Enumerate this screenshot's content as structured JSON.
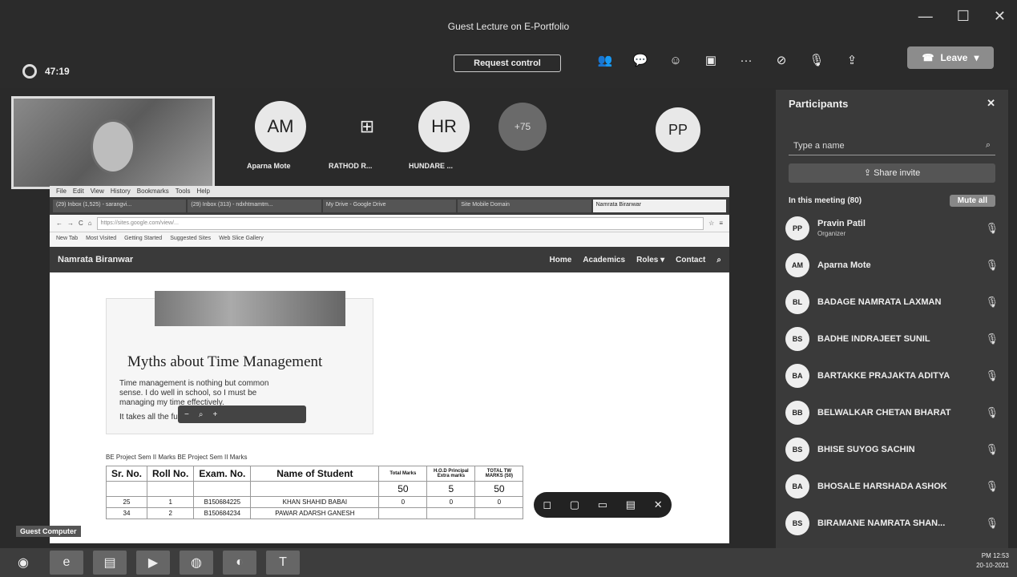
{
  "window": {
    "title": "Guest Lecture on E-Portfolio",
    "controls": [
      "—",
      "☐",
      "✕"
    ]
  },
  "meeting": {
    "timer": "47:19",
    "request_control": "Request control",
    "toolbar_icons": [
      "people-icon",
      "chat-icon",
      "reactions-icon",
      "view-icon",
      "more-icon",
      "camera-off-icon",
      "mic-off-icon",
      "share-icon"
    ],
    "leave_label": "Leave"
  },
  "stage": {
    "avatars": [
      {
        "initials": "AM",
        "name": "Aparna Mote"
      },
      {
        "initials": "⊞",
        "name": "RATHOD R..."
      },
      {
        "initials": "HR",
        "name": "HUNDARE ..."
      },
      {
        "initials": "+75",
        "name": ""
      },
      {
        "initials": "PP",
        "name": ""
      }
    ],
    "guest_label": "Guest Computer"
  },
  "browser": {
    "menu": [
      "File",
      "Edit",
      "View",
      "History",
      "Bookmarks",
      "Tools",
      "Help"
    ],
    "tabs": [
      "(29) Inbox (1,525) - sarangvi...",
      "(29) Inbox (313) - ndxhtmamtm...",
      "My Drive - Google Drive",
      "Site Mobile Domain",
      "Namrata Biranwar"
    ],
    "url": "https://sites.google.com/view/...",
    "bookmarks": [
      "New Tab",
      "Most Visited",
      "Getting Started",
      "Suggested Sites",
      "Web Slice Gallery"
    ],
    "site_logo": "Namrata Biranwar",
    "nav": [
      "Home",
      "Academics",
      "Roles ▾",
      "Contact"
    ]
  },
  "slide": {
    "title": "Myths about Time Management",
    "bullet1": "Time management is nothing but common sense. I do well in school, so I must be managing my time effectively.",
    "bullet2": "It takes all the fun out of life!"
  },
  "marks": {
    "caption": "BE Project Sem II Marks   BE Project Sem II Marks",
    "headers": [
      "Sr. No.",
      "Roll No.",
      "Exam. No.",
      "Name of Student",
      "Total Marks",
      "H.O.D Principal Extra marks",
      "TOTAL TW MARKS (50)"
    ],
    "max_row": [
      "",
      "",
      "",
      "",
      "50",
      "5",
      "50"
    ],
    "rows": [
      [
        "25",
        "1",
        "B150684225",
        "KHAN SHAHID BABAI",
        "0",
        "0",
        "0"
      ],
      [
        "34",
        "2",
        "B150684234",
        "PAWAR ADARSH GANESH",
        "",
        "",
        ""
      ]
    ]
  },
  "participants": {
    "title": "Participants",
    "search_placeholder": "Type a name",
    "share_invite": "Share invite",
    "in_meeting": "In this meeting (80)",
    "mute_all": "Mute all",
    "list": [
      {
        "initials": "PP",
        "name": "Pravin Patil",
        "role": "Organizer"
      },
      {
        "initials": "AM",
        "name": "Aparna Mote",
        "role": ""
      },
      {
        "initials": "BL",
        "name": "BADAGE NAMRATA LAXMAN",
        "role": ""
      },
      {
        "initials": "BS",
        "name": "BADHE INDRAJEET SUNIL",
        "role": ""
      },
      {
        "initials": "BA",
        "name": "BARTAKKE PRAJAKTA ADITYA",
        "role": ""
      },
      {
        "initials": "BB",
        "name": "BELWALKAR CHETAN BHARAT",
        "role": ""
      },
      {
        "initials": "BS",
        "name": "BHISE SUYOG SACHIN",
        "role": ""
      },
      {
        "initials": "BA",
        "name": "BHOSALE HARSHADA ASHOK",
        "role": ""
      },
      {
        "initials": "BS",
        "name": "BIRAMANE NAMRATA SHAN...",
        "role": ""
      }
    ]
  },
  "taskbar": {
    "time": "PM 12:53",
    "date": "20-10-2021"
  }
}
